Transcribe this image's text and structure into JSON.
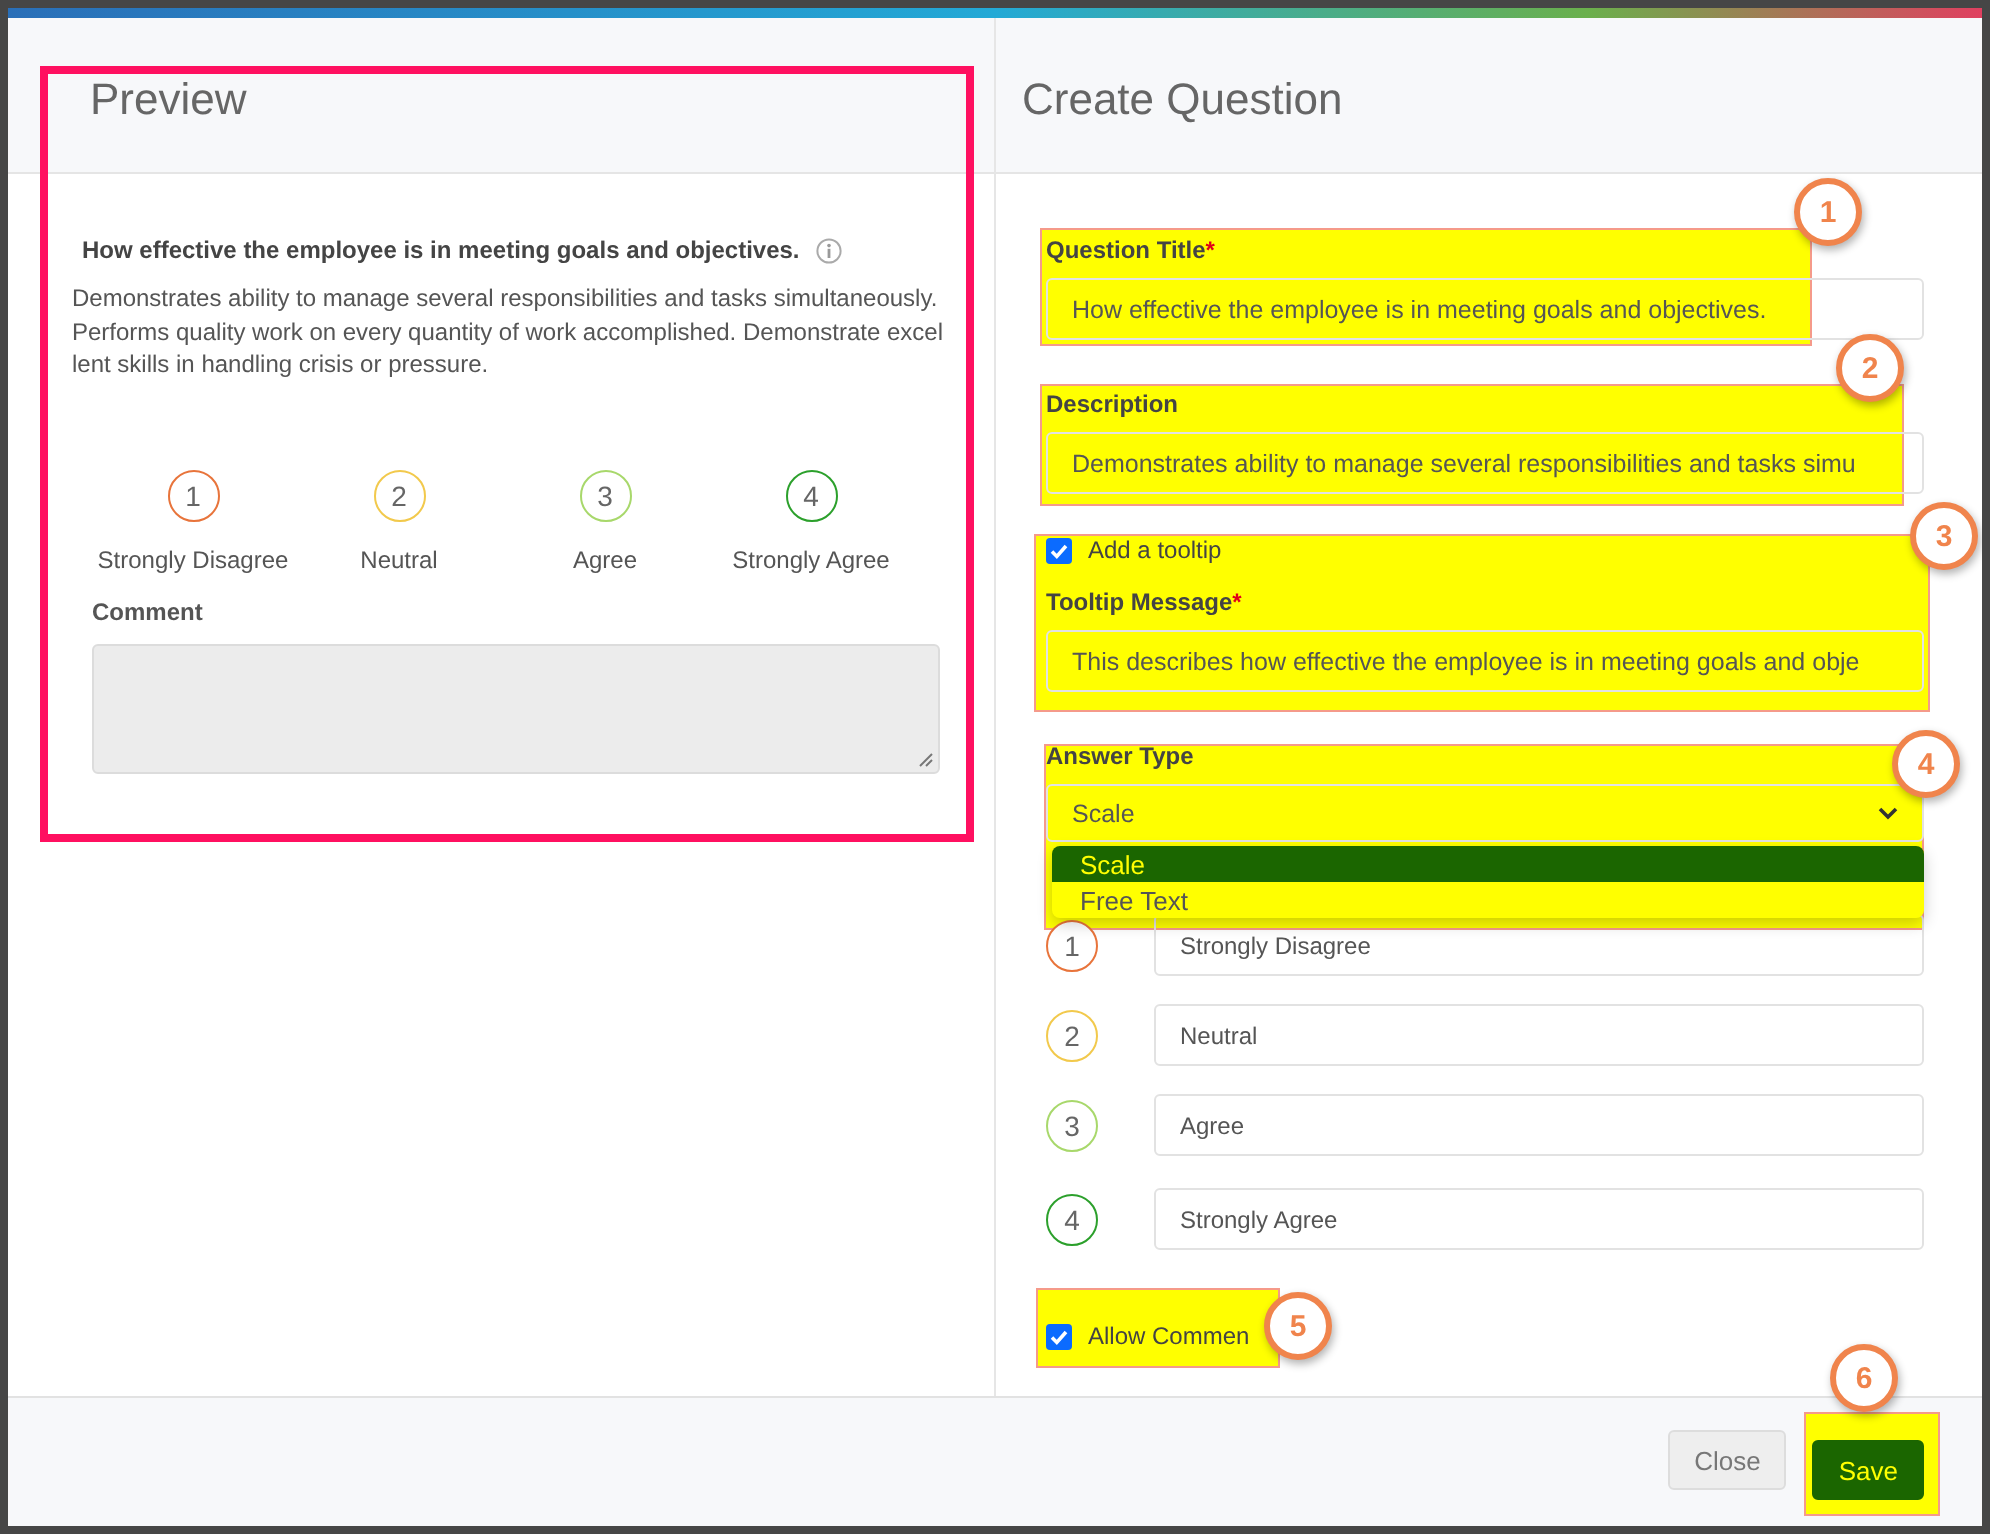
{
  "preview": {
    "title": "Preview",
    "question": "How effective the employee is in meeting goals and objectives.",
    "description": "Demonstrates ability to manage several responsibilities and tasks simultaneously. Performs quality work on every quantity of work accomplished. Demonstrate excellent skills in handling crisis or pressure.",
    "scale": [
      {
        "number": "1",
        "label": "Strongly Disagree",
        "color": "#e8743b"
      },
      {
        "number": "2",
        "label": "Neutral",
        "color": "#f2c94c"
      },
      {
        "number": "3",
        "label": "Agree",
        "color": "#a8d86b"
      },
      {
        "number": "4",
        "label": "Strongly Agree",
        "color": "#2ca02c"
      }
    ],
    "comment_label": "Comment"
  },
  "form": {
    "title": "Create Question",
    "question_title": {
      "label": "Question Title",
      "marker": "*",
      "value": "How effective the employee is in meeting goals and objectives."
    },
    "description": {
      "label": "Description",
      "value": "Demonstrates ability to manage several responsibilities and tasks simu"
    },
    "tooltip_toggle": {
      "label": "Add a tooltip",
      "checked": true
    },
    "tooltip_message": {
      "label": "Tooltip Message",
      "marker": "*",
      "value": "This describes how effective the employee is in meeting goals and obje"
    },
    "answer_type": {
      "label": "Answer Type",
      "value": "Scale",
      "options": [
        {
          "label": "Scale",
          "selected": true
        },
        {
          "label": "Free Text",
          "selected": false
        }
      ]
    },
    "scale": [
      {
        "number": "1",
        "value": "Strongly Disagree",
        "color": "#e8743b"
      },
      {
        "number": "2",
        "value": "Neutral",
        "color": "#f2c94c"
      },
      {
        "number": "3",
        "value": "Agree",
        "color": "#a8d86b"
      },
      {
        "number": "4",
        "value": "Strongly Agree",
        "color": "#2ca02c"
      }
    ],
    "allow_comment": {
      "label": "Allow Commen",
      "checked": true
    }
  },
  "buttons": [
    {
      "label": "Close",
      "kind": "secondary"
    },
    {
      "label": "Save",
      "kind": "primary"
    }
  ],
  "callouts": [
    "1",
    "2",
    "3",
    "4",
    "5",
    "6"
  ]
}
